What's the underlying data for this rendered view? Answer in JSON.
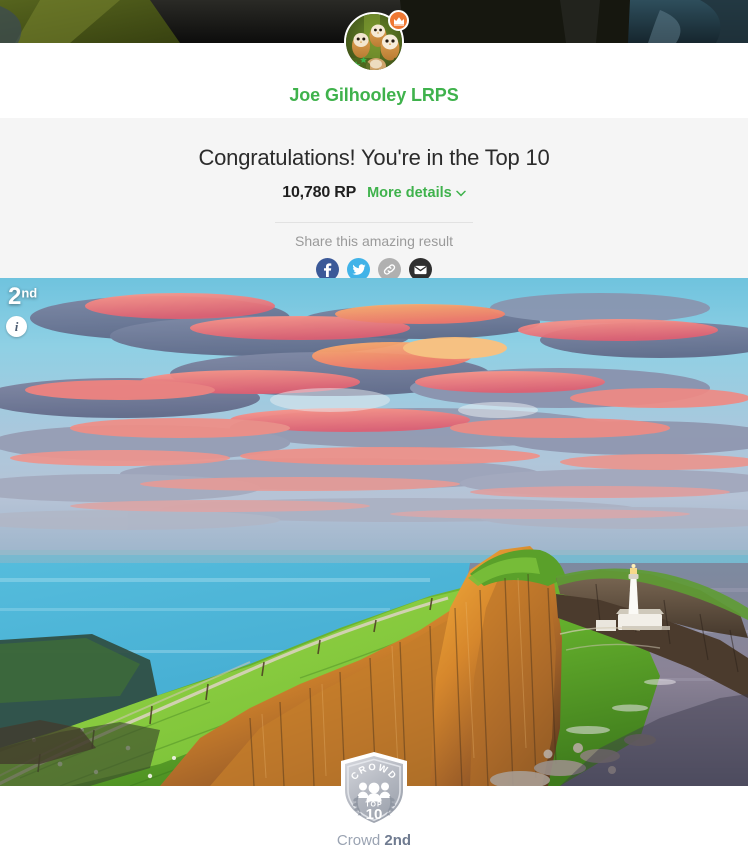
{
  "cover": {
    "name": "cover-photo",
    "description": "dark cliff landscape banner"
  },
  "profile": {
    "avatar_alt": "owls-avatar",
    "crown_icon": "crown-icon",
    "star_icon": "star-icon",
    "name": "Joe Gilhooley LRPS",
    "name_color": "#3fb24c"
  },
  "result": {
    "headline": "Congratulations! You're in the Top 10",
    "rp_value": "10,780 RP",
    "more_details_label": "More details",
    "chevron_icon": "chevron-down-icon",
    "share_label": "Share this amazing result",
    "share_buttons": [
      {
        "name": "share-facebook-button",
        "icon": "facebook-icon",
        "glyph": "f",
        "color": "#3b5998"
      },
      {
        "name": "share-twitter-button",
        "icon": "twitter-icon",
        "glyph": "t",
        "color": "#41b3e8"
      },
      {
        "name": "share-link-button",
        "icon": "link-icon",
        "glyph": "link",
        "color": "#b0b0b0"
      },
      {
        "name": "share-email-button",
        "icon": "email-icon",
        "glyph": "mail",
        "color": "#2f2f2f"
      }
    ]
  },
  "photo": {
    "alt": "sunset-cliff-lighthouse-photo",
    "rank_number": "2",
    "rank_suffix": "nd",
    "info_icon": "info-icon",
    "info_glyph": "i"
  },
  "crowd": {
    "badge_icon": "crowd-top-10-shield-badge",
    "badge_word": "CROWD",
    "badge_top_label": "TOP",
    "badge_top_number": "10",
    "caption_prefix": "Crowd ",
    "caption_rank": "2nd"
  }
}
